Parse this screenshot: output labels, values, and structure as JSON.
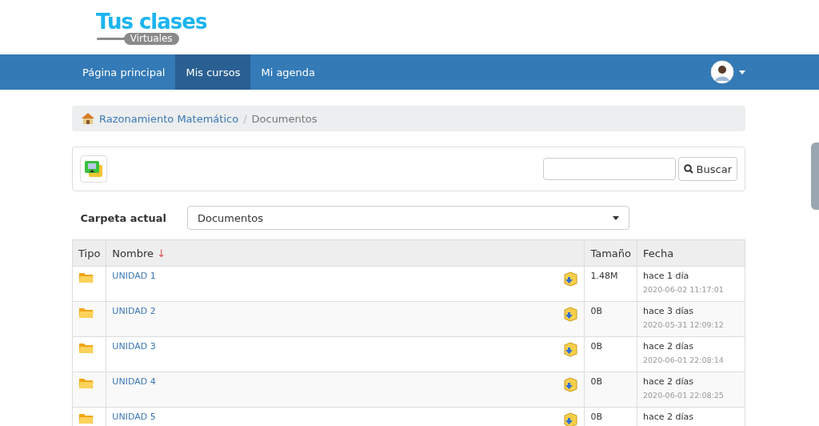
{
  "logo": {
    "title": "Tus clases",
    "subtitle": "Virtuales"
  },
  "nav": {
    "items": [
      {
        "label": "Página principal",
        "selected": false
      },
      {
        "label": "Mis cursos",
        "selected": true
      },
      {
        "label": "Mi agenda",
        "selected": false
      }
    ]
  },
  "breadcrumb": [
    {
      "label": "Razonamiento Matemático",
      "kind": "link"
    },
    {
      "label": "Documentos",
      "kind": "current"
    }
  ],
  "breadcrumb_separator": "/",
  "search": {
    "button": "Buscar"
  },
  "folder": {
    "label": "Carpeta actual",
    "value": "Documentos"
  },
  "table": {
    "columns": [
      "Tipo",
      "Nombre",
      "Tamaño",
      "Fecha"
    ],
    "sort_mark": "↓",
    "rows": [
      {
        "name": "UNIDAD 1",
        "size": "1.48M",
        "ago": "hace 1 día",
        "date": "2020-06-02 11:17:01"
      },
      {
        "name": "UNIDAD 2",
        "size": "0B",
        "ago": "hace 3 días",
        "date": "2020-05-31 12:09:12"
      },
      {
        "name": "UNIDAD 3",
        "size": "0B",
        "ago": "hace 2 días",
        "date": "2020-06-01 22:08:14"
      },
      {
        "name": "UNIDAD 4",
        "size": "0B",
        "ago": "hace 2 días",
        "date": "2020-06-01 22:08:25"
      },
      {
        "name": "UNIDAD 5",
        "size": "0B",
        "ago": "hace 2 días"
      }
    ]
  }
}
